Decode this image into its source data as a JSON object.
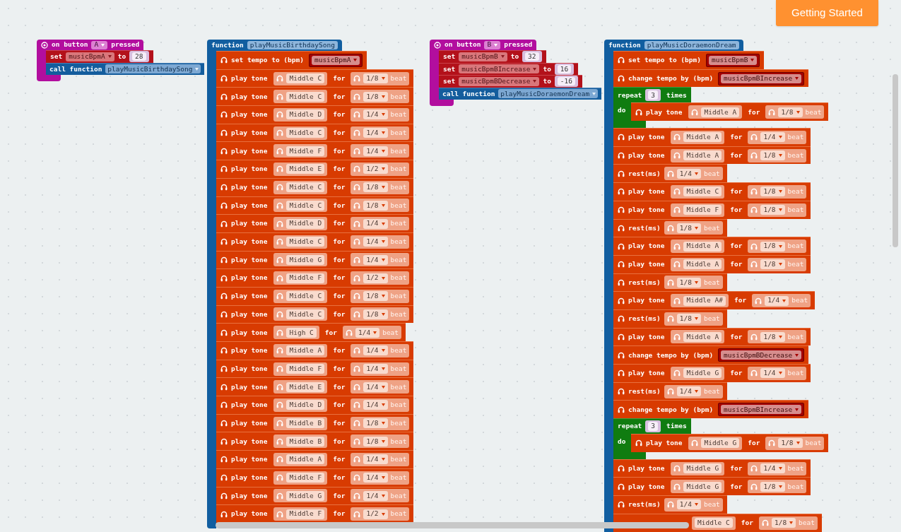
{
  "button": {
    "label": "Getting Started"
  },
  "stacks": [
    {
      "kind": "event",
      "before": "on button",
      "button": "A",
      "after": "pressed",
      "body": [
        {
          "kind": "set",
          "label": "set",
          "variable": "musicBpmA",
          "to": "to",
          "value": "28"
        },
        {
          "kind": "call",
          "label": "call function",
          "name": "playMusicBirthdaySong"
        }
      ]
    },
    {
      "kind": "function",
      "keyword": "function",
      "name": "playMusicBirthdaySong",
      "body": [
        {
          "kind": "tempo",
          "label": "set tempo to (bpm)",
          "variable": "musicBpmA"
        },
        {
          "kind": "tone",
          "label": "play tone",
          "note": "Middle C",
          "for": "for",
          "duration": "1/8",
          "unit": "beat"
        },
        {
          "kind": "tone",
          "label": "play tone",
          "note": "Middle C",
          "for": "for",
          "duration": "1/8",
          "unit": "beat"
        },
        {
          "kind": "tone",
          "label": "play tone",
          "note": "Middle D",
          "for": "for",
          "duration": "1/4",
          "unit": "beat"
        },
        {
          "kind": "tone",
          "label": "play tone",
          "note": "Middle C",
          "for": "for",
          "duration": "1/4",
          "unit": "beat"
        },
        {
          "kind": "tone",
          "label": "play tone",
          "note": "Middle F",
          "for": "for",
          "duration": "1/4",
          "unit": "beat"
        },
        {
          "kind": "tone",
          "label": "play tone",
          "note": "Middle E",
          "for": "for",
          "duration": "1/2",
          "unit": "beat"
        },
        {
          "kind": "tone",
          "label": "play tone",
          "note": "Middle C",
          "for": "for",
          "duration": "1/8",
          "unit": "beat"
        },
        {
          "kind": "tone",
          "label": "play tone",
          "note": "Middle C",
          "for": "for",
          "duration": "1/8",
          "unit": "beat"
        },
        {
          "kind": "tone",
          "label": "play tone",
          "note": "Middle D",
          "for": "for",
          "duration": "1/4",
          "unit": "beat"
        },
        {
          "kind": "tone",
          "label": "play tone",
          "note": "Middle C",
          "for": "for",
          "duration": "1/4",
          "unit": "beat"
        },
        {
          "kind": "tone",
          "label": "play tone",
          "note": "Middle G",
          "for": "for",
          "duration": "1/4",
          "unit": "beat"
        },
        {
          "kind": "tone",
          "label": "play tone",
          "note": "Middle F",
          "for": "for",
          "duration": "1/2",
          "unit": "beat"
        },
        {
          "kind": "tone",
          "label": "play tone",
          "note": "Middle C",
          "for": "for",
          "duration": "1/8",
          "unit": "beat"
        },
        {
          "kind": "tone",
          "label": "play tone",
          "note": "Middle C",
          "for": "for",
          "duration": "1/8",
          "unit": "beat"
        },
        {
          "kind": "tone",
          "label": "play tone",
          "note": "High C",
          "for": "for",
          "duration": "1/4",
          "unit": "beat"
        },
        {
          "kind": "tone",
          "label": "play tone",
          "note": "Middle A",
          "for": "for",
          "duration": "1/4",
          "unit": "beat"
        },
        {
          "kind": "tone",
          "label": "play tone",
          "note": "Middle F",
          "for": "for",
          "duration": "1/4",
          "unit": "beat"
        },
        {
          "kind": "tone",
          "label": "play tone",
          "note": "Middle E",
          "for": "for",
          "duration": "1/4",
          "unit": "beat"
        },
        {
          "kind": "tone",
          "label": "play tone",
          "note": "Middle D",
          "for": "for",
          "duration": "1/4",
          "unit": "beat"
        },
        {
          "kind": "tone",
          "label": "play tone",
          "note": "Middle B",
          "for": "for",
          "duration": "1/8",
          "unit": "beat"
        },
        {
          "kind": "tone",
          "label": "play tone",
          "note": "Middle B",
          "for": "for",
          "duration": "1/8",
          "unit": "beat"
        },
        {
          "kind": "tone",
          "label": "play tone",
          "note": "Middle A",
          "for": "for",
          "duration": "1/4",
          "unit": "beat"
        },
        {
          "kind": "tone",
          "label": "play tone",
          "note": "Middle F",
          "for": "for",
          "duration": "1/4",
          "unit": "beat"
        },
        {
          "kind": "tone",
          "label": "play tone",
          "note": "Middle G",
          "for": "for",
          "duration": "1/4",
          "unit": "beat"
        },
        {
          "kind": "tone",
          "label": "play tone",
          "note": "Middle F",
          "for": "for",
          "duration": "1/2",
          "unit": "beat"
        }
      ]
    },
    {
      "kind": "event",
      "before": "on button",
      "button": "B",
      "after": "pressed",
      "body": [
        {
          "kind": "set",
          "label": "set",
          "variable": "musicBpmB",
          "to": "to",
          "value": "32"
        },
        {
          "kind": "set",
          "label": "set",
          "variable": "musicBpmBIncrease",
          "to": "to",
          "value": "16"
        },
        {
          "kind": "set",
          "label": "set",
          "variable": "musicBpmBDecrease",
          "to": "to",
          "value": "-16"
        },
        {
          "kind": "call",
          "label": "call function",
          "name": "playMusicDoraemonDream"
        }
      ]
    },
    {
      "kind": "function",
      "keyword": "function",
      "name": "playMusicDoraemonDream",
      "body": [
        {
          "kind": "tempo",
          "label": "set tempo to (bpm)",
          "variable": "musicBpmB"
        },
        {
          "kind": "tempo",
          "label": "change tempo by (bpm)",
          "variable": "musicBpmBIncrease"
        },
        {
          "kind": "repeat",
          "label": "repeat",
          "count": "3",
          "times": "times",
          "do": "do",
          "body": [
            {
              "kind": "tone",
              "label": "play tone",
              "note": "Middle A",
              "for": "for",
              "duration": "1/8",
              "unit": "beat"
            }
          ]
        },
        {
          "kind": "tone",
          "label": "play tone",
          "note": "Middle A",
          "for": "for",
          "duration": "1/4",
          "unit": "beat"
        },
        {
          "kind": "tone",
          "label": "play tone",
          "note": "Middle A",
          "for": "for",
          "duration": "1/8",
          "unit": "beat"
        },
        {
          "kind": "rest",
          "label": "rest(ms)",
          "duration": "1/4",
          "unit": "beat"
        },
        {
          "kind": "tone",
          "label": "play tone",
          "note": "Middle C",
          "for": "for",
          "duration": "1/8",
          "unit": "beat"
        },
        {
          "kind": "tone",
          "label": "play tone",
          "note": "Middle F",
          "for": "for",
          "duration": "1/8",
          "unit": "beat"
        },
        {
          "kind": "rest",
          "label": "rest(ms)",
          "duration": "1/8",
          "unit": "beat"
        },
        {
          "kind": "tone",
          "label": "play tone",
          "note": "Middle A",
          "for": "for",
          "duration": "1/8",
          "unit": "beat"
        },
        {
          "kind": "tone",
          "label": "play tone",
          "note": "Middle A",
          "for": "for",
          "duration": "1/8",
          "unit": "beat"
        },
        {
          "kind": "rest",
          "label": "rest(ms)",
          "duration": "1/8",
          "unit": "beat"
        },
        {
          "kind": "tone",
          "label": "play tone",
          "note": "Middle A#",
          "for": "for",
          "duration": "1/4",
          "unit": "beat"
        },
        {
          "kind": "rest",
          "label": "rest(ms)",
          "duration": "1/8",
          "unit": "beat"
        },
        {
          "kind": "tone",
          "label": "play tone",
          "note": "Middle A",
          "for": "for",
          "duration": "1/8",
          "unit": "beat"
        },
        {
          "kind": "tempo",
          "label": "change tempo by (bpm)",
          "variable": "musicBpmBDecrease"
        },
        {
          "kind": "tone",
          "label": "play tone",
          "note": "Middle G",
          "for": "for",
          "duration": "1/4",
          "unit": "beat"
        },
        {
          "kind": "rest",
          "label": "rest(ms)",
          "duration": "1/4",
          "unit": "beat"
        },
        {
          "kind": "tempo",
          "label": "change tempo by (bpm)",
          "variable": "musicBpmBIncrease"
        },
        {
          "kind": "repeat",
          "label": "repeat",
          "count": "3",
          "times": "times",
          "do": "do",
          "body": [
            {
              "kind": "tone",
              "label": "play tone",
              "note": "Middle G",
              "for": "for",
              "duration": "1/8",
              "unit": "beat"
            }
          ]
        },
        {
          "kind": "tone",
          "label": "play tone",
          "note": "Middle G",
          "for": "for",
          "duration": "1/4",
          "unit": "beat"
        },
        {
          "kind": "tone",
          "label": "play tone",
          "note": "Middle G",
          "for": "for",
          "duration": "1/8",
          "unit": "beat"
        },
        {
          "kind": "rest",
          "label": "rest(ms)",
          "duration": "1/4",
          "unit": "beat"
        },
        {
          "kind": "tone_cut",
          "note": "Middle C",
          "for": "for",
          "duration": "1/8",
          "unit": "beat"
        }
      ]
    }
  ]
}
